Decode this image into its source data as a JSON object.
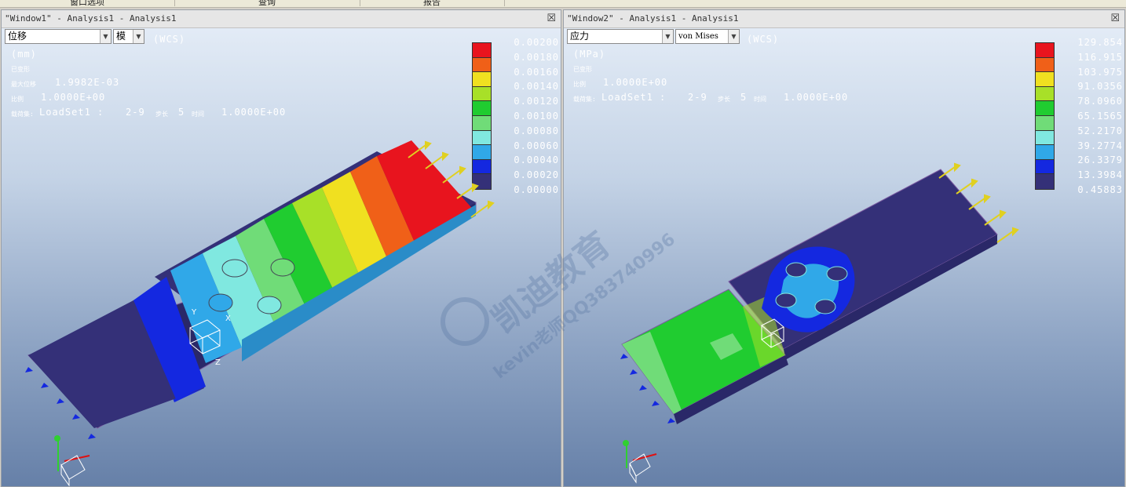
{
  "menu_tabs": [
    "窗口选项",
    "查询",
    "报告"
  ],
  "window1": {
    "title": "\"Window1\" - Analysis1 - Analysis1",
    "quantity": "位移",
    "component": "模",
    "coord": "(WCS)",
    "unit": "(mm)",
    "deformed": "已变形",
    "max_label": "最大位移",
    "max_value": "1.9982E-03",
    "scale_label": "比例",
    "scale_value": "1.0000E+00",
    "loadset_label": "载荷集:",
    "loadset": "LoadSet1 :",
    "pass": "2-9",
    "step_label": "步长",
    "step": "5",
    "time_label": "时间",
    "time": "1.0000E+00",
    "legend": [
      "0.00200",
      "0.00180",
      "0.00160",
      "0.00140",
      "0.00120",
      "0.00100",
      "0.00080",
      "0.00060",
      "0.00040",
      "0.00020",
      "0.00000"
    ],
    "colors": [
      "#e8141e",
      "#f06018",
      "#f0e020",
      "#a8e028",
      "#20cc30",
      "#70dc78",
      "#80e8e0",
      "#30a8e8",
      "#1428e0",
      "#343078"
    ]
  },
  "window2": {
    "title": "\"Window2\" - Analysis1 - Analysis1",
    "quantity": "应力",
    "component": "von Mises",
    "coord": "(WCS)",
    "unit": "(MPa)",
    "deformed": "已变形",
    "scale_label": "比例",
    "scale_value": "1.0000E+00",
    "loadset_label": "载荷集:",
    "loadset": "LoadSet1 :",
    "pass": "2-9",
    "step_label": "步长",
    "step": "5",
    "time_label": "时间",
    "time": "1.0000E+00",
    "legend": [
      "129.854",
      "116.915",
      "103.975",
      "91.0356",
      "78.0960",
      "65.1565",
      "52.2170",
      "39.2774",
      "26.3379",
      "13.3984",
      "0.45883"
    ],
    "colors": [
      "#e8141e",
      "#f06018",
      "#f0e020",
      "#a8e028",
      "#20cc30",
      "#70dc78",
      "#80e8e0",
      "#30a8e8",
      "#1428e0",
      "#343078"
    ]
  },
  "watermark": {
    "brand": "凯迪教育",
    "line2": "kevin老师QQ383740996"
  }
}
